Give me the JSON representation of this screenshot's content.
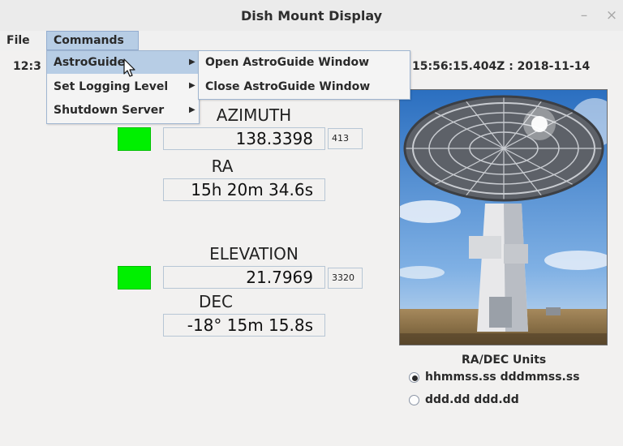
{
  "window": {
    "title": "Dish Mount Display",
    "minimize": "–",
    "close": "×"
  },
  "menubar": {
    "file": "File",
    "commands": "Commands"
  },
  "commands_menu": {
    "items": [
      {
        "label": "AstroGuide"
      },
      {
        "label": "Set Logging Level"
      },
      {
        "label": "Shutdown Server"
      }
    ]
  },
  "astroguide_submenu": {
    "items": [
      {
        "label": "Open AstroGuide Window"
      },
      {
        "label": "Close AstroGuide Window"
      }
    ]
  },
  "status": {
    "local_time_partial": "12:3",
    "utc": "15:56:15.404Z : 2018-11-14"
  },
  "azimuth": {
    "label": "AZIMUTH",
    "value": "138.3398",
    "raw": "413"
  },
  "ra": {
    "label": "RA",
    "value": "15h 20m 34.6s"
  },
  "elevation": {
    "label": "ELEVATION",
    "value": "21.7969",
    "raw": "3320"
  },
  "dec": {
    "label": "DEC",
    "value": "-18° 15m 15.8s"
  },
  "units": {
    "title": "RA/DEC Units",
    "options": [
      {
        "label": "hhmmss.ss dddmmss.ss",
        "selected": true
      },
      {
        "label": "ddd.dd ddd.dd",
        "selected": false
      }
    ]
  },
  "colors": {
    "status_ok": "#00f000",
    "menu_highlight": "#b7cde5"
  },
  "icons": {
    "photo": "radio-dish-photo",
    "pointer": "mouse-pointer"
  }
}
